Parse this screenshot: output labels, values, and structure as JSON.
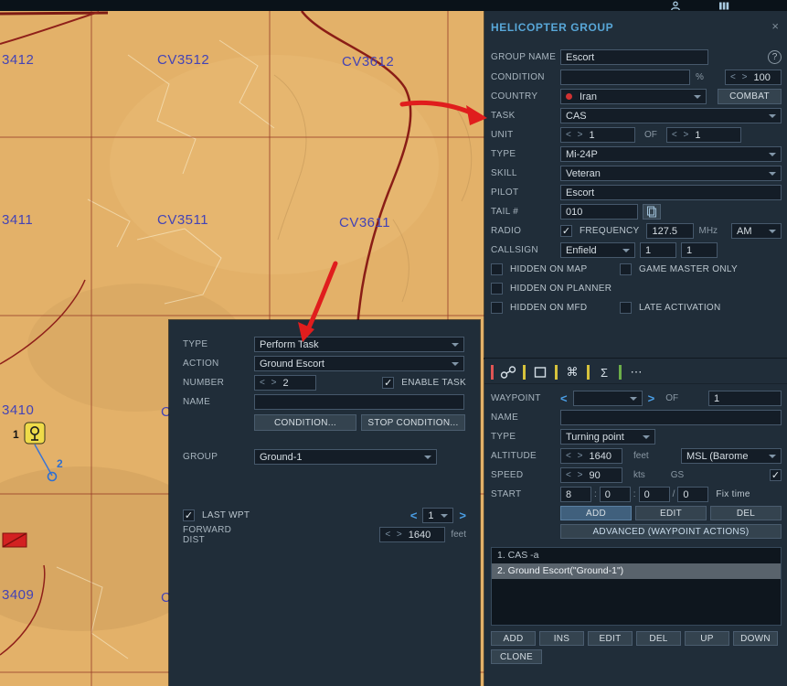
{
  "colors": {
    "annotation_arrow": "#e01d1d",
    "panel_bg": "#202d39",
    "accent_blue": "#4b9fe6",
    "selection_bg": "#59636c",
    "map_bg": "#e3b169",
    "toolbar_bars": [
      "#e05555",
      "#d6c23c",
      "#d6c23c",
      "#d6c23c",
      "#6cae49"
    ]
  },
  "icons": {
    "close": "×",
    "help": "?",
    "nav_left": "<",
    "nav_right": ">",
    "spin_arrows": "< >",
    "command": "⌘",
    "sigma": "Σ",
    "dots": "⋯",
    "colon": ":",
    "slash": "/"
  },
  "map": {
    "grid_labels": [
      "3412",
      "CV3512",
      "CV3612",
      "3411",
      "CV3511",
      "CV3611",
      "3410",
      "C",
      "3409",
      "C"
    ],
    "unit_labels": {
      "helicopter": "1",
      "waypoint": "2"
    }
  },
  "helicopter_group": {
    "title": "HELICOPTER GROUP",
    "group_name": {
      "label": "GROUP NAME",
      "value": "Escort"
    },
    "condition": {
      "label": "CONDITION",
      "value": "",
      "percent": "%",
      "max": "100"
    },
    "country": {
      "label": "COUNTRY",
      "value": "Iran",
      "combat": "COMBAT"
    },
    "task": {
      "label": "TASK",
      "value": "CAS"
    },
    "unit": {
      "label": "UNIT",
      "count": "1",
      "of": "OF",
      "total": "1"
    },
    "type": {
      "label": "TYPE",
      "value": "Mi-24P"
    },
    "skill": {
      "label": "SKILL",
      "value": "Veteran"
    },
    "pilot": {
      "label": "PILOT",
      "value": "Escort"
    },
    "tail": {
      "label": "TAIL #",
      "value": "010"
    },
    "radio": {
      "label": "RADIO",
      "frequency_label": "FREQUENCY",
      "frequency": "127.5",
      "unit": "MHz",
      "modulation": "AM"
    },
    "callsign": {
      "label": "CALLSIGN",
      "name": "Enfield",
      "flight": "1",
      "number": "1"
    },
    "checks": {
      "hidden_map": "HIDDEN ON MAP",
      "game_master": "GAME MASTER ONLY",
      "hidden_planner": "HIDDEN ON PLANNER",
      "hidden_mfd": "HIDDEN ON MFD",
      "late_activation": "LATE ACTIVATION"
    }
  },
  "task_dialog": {
    "type": {
      "label": "TYPE",
      "value": "Perform Task"
    },
    "action": {
      "label": "ACTION",
      "value": "Ground Escort"
    },
    "number": {
      "label": "NUMBER",
      "value": "2",
      "enable": "ENABLE TASK"
    },
    "name": {
      "label": "NAME",
      "value": ""
    },
    "condition_button": "CONDITION...",
    "stop_condition_button": "STOP CONDITION...",
    "group": {
      "label": "GROUP",
      "value": "Ground-1"
    },
    "last_wpt": {
      "label": "LAST WPT",
      "value": "1"
    },
    "forward_dist": {
      "label": "FORWARD DIST",
      "value": "1640",
      "unit": "feet"
    }
  },
  "waypoint_panel": {
    "waypoint": {
      "label": "WAYPOINT",
      "value": "",
      "of": "OF",
      "total": "1"
    },
    "name": {
      "label": "NAME",
      "value": ""
    },
    "type": {
      "label": "TYPE",
      "value": "Turning point"
    },
    "altitude": {
      "label": "ALTITUDE",
      "value": "1640",
      "unit": "feet",
      "reference": "MSL (Barome"
    },
    "speed": {
      "label": "SPEED",
      "value": "90",
      "unit": "kts",
      "mode": "GS"
    },
    "start": {
      "label": "START",
      "hours": "8",
      "minutes": "0",
      "seconds": "0",
      "day": "0",
      "fix_time": "Fix time"
    },
    "edit_buttons": [
      "ADD",
      "EDIT",
      "DEL"
    ],
    "advanced_button": "ADVANCED (WAYPOINT ACTIONS)",
    "actions": [
      "1. CAS -a",
      "2. Ground Escort(\"Ground-1\")"
    ],
    "list_buttons": [
      "ADD",
      "INS",
      "EDIT",
      "DEL",
      "UP",
      "DOWN"
    ],
    "clone_button": "CLONE"
  }
}
